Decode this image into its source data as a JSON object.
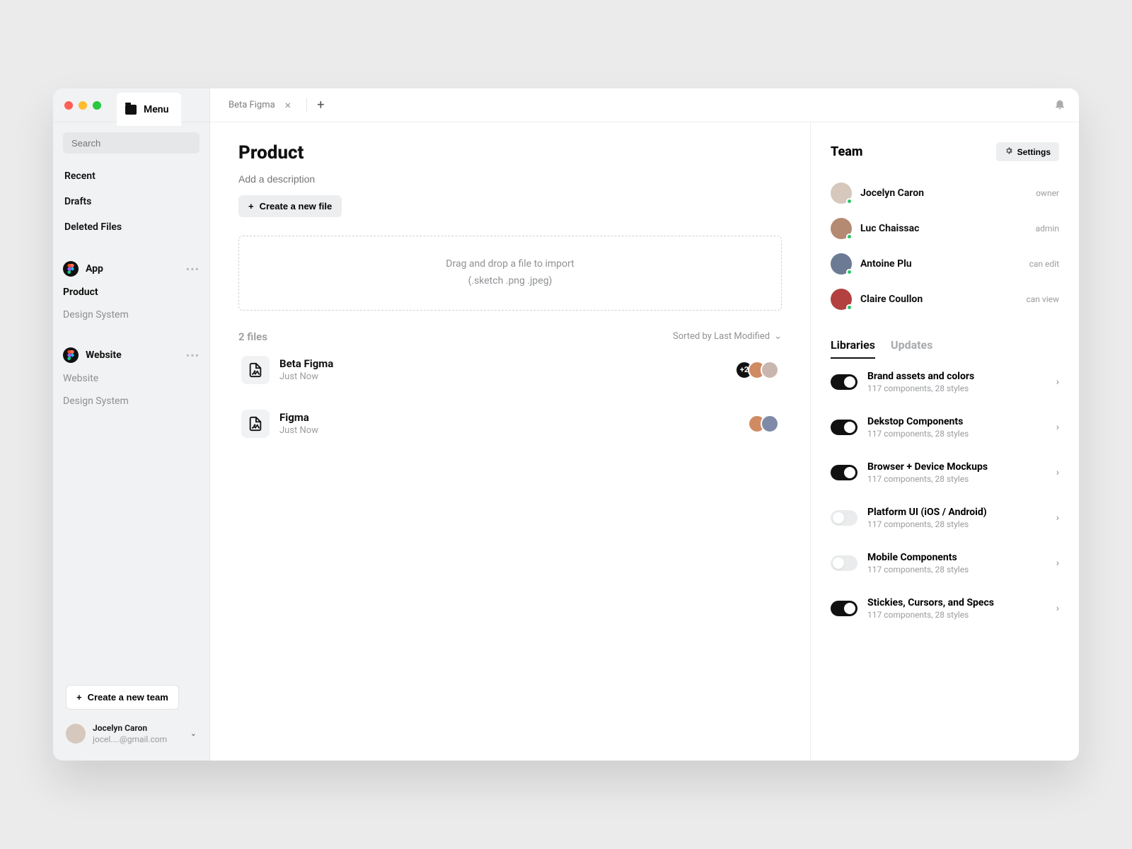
{
  "sidebar": {
    "menu_label": "Menu",
    "search_placeholder": "Search",
    "nav": {
      "recent": "Recent",
      "drafts": "Drafts",
      "deleted": "Deleted Files"
    },
    "projects": [
      {
        "title": "App",
        "items": [
          {
            "label": "Product",
            "active": true
          },
          {
            "label": "Design System",
            "active": false
          }
        ]
      },
      {
        "title": "Website",
        "items": [
          {
            "label": "Website",
            "active": false
          },
          {
            "label": "Design System",
            "active": false
          }
        ]
      }
    ],
    "new_team": "Create a new team",
    "user": {
      "name": "Jocelyn Caron",
      "email": "jocel....@gmail.com"
    }
  },
  "tabbar": {
    "file": "Beta Figma"
  },
  "page": {
    "title": "Product",
    "description_placeholder": "Add a description",
    "create_file": "Create a new file",
    "drop_hint": "Drag and drop a file to import",
    "drop_types": "(.sketch .png .jpeg)",
    "files_count": "2 files",
    "sort_label": "Sorted by Last Modified",
    "files": [
      {
        "name": "Beta Figma",
        "time": "Just Now",
        "extra_count": "+2",
        "avatar_colors": [
          "#d08b63",
          "#c9b7af"
        ]
      },
      {
        "name": "Figma",
        "time": "Just Now",
        "extra_count": "",
        "avatar_colors": [
          "#d08b63",
          "#7e8aa8"
        ]
      }
    ]
  },
  "team": {
    "title": "Team",
    "settings": "Settings",
    "members": [
      {
        "name": "Jocelyn Caron",
        "role": "owner",
        "avatar": "#d6c8bd"
      },
      {
        "name": "Luc Chaissac",
        "role": "admin",
        "avatar": "#b58a72"
      },
      {
        "name": "Antoine Plu",
        "role": "can edit",
        "avatar": "#6d7a94"
      },
      {
        "name": "Claire Coullon",
        "role": "can view",
        "avatar": "#b2413f"
      }
    ]
  },
  "panel_tabs": {
    "libraries": "Libraries",
    "updates": "Updates"
  },
  "libraries": [
    {
      "name": "Brand assets and colors",
      "sub": "117 components, 28 styles",
      "on": true
    },
    {
      "name": "Dekstop Components",
      "sub": "117 components, 28 styles",
      "on": true
    },
    {
      "name": "Browser + Device Mockups",
      "sub": "117 components, 28 styles",
      "on": true
    },
    {
      "name": "Platform UI (iOS / Android)",
      "sub": "117 components, 28 styles",
      "on": false
    },
    {
      "name": "Mobile Components",
      "sub": "117 components, 28 styles",
      "on": false
    },
    {
      "name": "Stickies, Cursors, and Specs",
      "sub": "117 components, 28 styles",
      "on": true
    }
  ]
}
